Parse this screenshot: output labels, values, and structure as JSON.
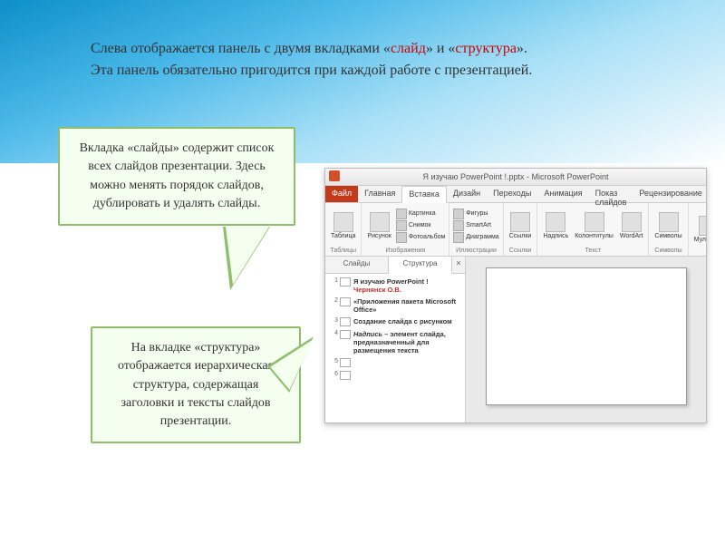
{
  "header": {
    "line1_part1": "Слева отображается панель с двумя вкладками «",
    "line1_red1": "слайд",
    "line1_part2": "» и «",
    "line1_red2": "структура",
    "line1_part3": "».",
    "line2": "Эта панель обязательно пригодится при каждой работе с презентацией."
  },
  "callout1": "Вкладка «слайды» содержит список всех слайдов презентации. Здесь можно менять порядок слайдов, дублировать и удалять слайды.",
  "callout2": "На вкладке «структура» отображается иерархическая структура, содержащая заголовки и тексты слайдов презентации.",
  "pp": {
    "title": "Я изучаю PowerPoint !.pptx - Microsoft PowerPoint",
    "tabs": {
      "file": "Файл",
      "home": "Главная",
      "insert": "Вставка",
      "design": "Дизайн",
      "transitions": "Переходы",
      "animation": "Анимация",
      "slideshow": "Показ слайдов",
      "review": "Рецензирование"
    },
    "ribbon": {
      "group_tables": "Таблицы",
      "table": "Таблица",
      "group_images": "Изображения",
      "picture": "Рисунок",
      "clipart": "Картинка",
      "screenshot": "Снимок",
      "photoalbum": "Фотоальбом",
      "group_illustrations": "Иллюстрации",
      "shapes": "Фигуры",
      "smartart": "SmartArt",
      "chart": "Диаграмма",
      "group_links": "Ссылки",
      "links": "Ссылки",
      "group_text": "Текст",
      "textbox": "Надпись",
      "headerfooter": "Колонтитулы",
      "wordart": "WordArt",
      "group_symbols": "Символы",
      "symbols": "Символы",
      "group_media": "Мультиме"
    },
    "outline_tabs": {
      "slides": "Слайды",
      "structure": "Структура"
    },
    "outline": [
      {
        "num": "1",
        "title": "Я изучаю PowerPoint !",
        "author": "Чернянск О.В."
      },
      {
        "num": "2",
        "title": "«Приложения пакета Microsoft Office»"
      },
      {
        "num": "3",
        "title": "Создание слайда с рисунком"
      },
      {
        "num": "4",
        "title": "Надпись – элемент слайда, предназначенный для размещения текста",
        "italic_prefix": "Надпись"
      },
      {
        "num": "5",
        "title": ""
      },
      {
        "num": "6",
        "title": ""
      }
    ]
  }
}
